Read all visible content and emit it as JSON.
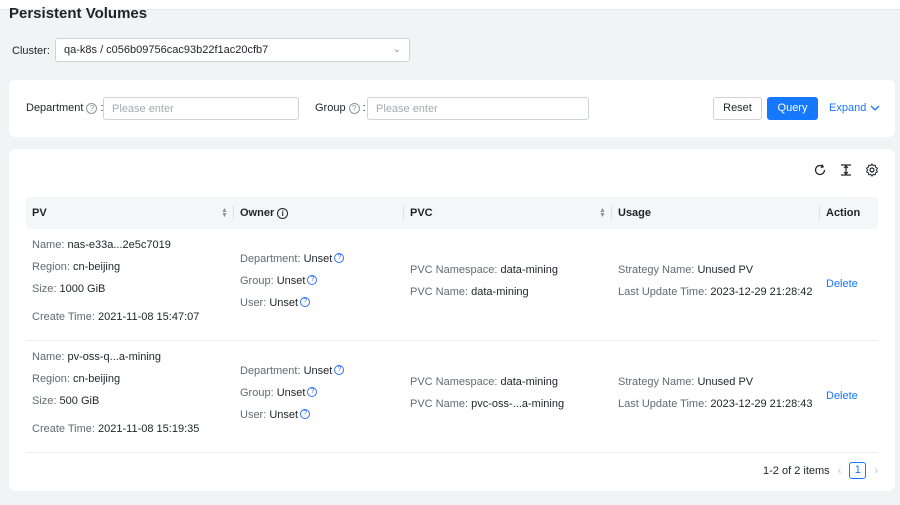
{
  "page": {
    "title": "Persistent Volumes"
  },
  "cluster": {
    "label": "Cluster:",
    "value": "qa-k8s / c056b09756cac93b22f1ac20cfb7"
  },
  "filters": {
    "department_label": "Department",
    "department_placeholder": "Please enter",
    "group_label": "Group",
    "group_placeholder": "Please enter",
    "reset_label": "Reset",
    "query_label": "Query",
    "expand_label": "Expand"
  },
  "table": {
    "columns": [
      "PV",
      "Owner",
      "PVC",
      "Usage",
      "Action"
    ],
    "rows": [
      {
        "pv": {
          "name_key": "Name:",
          "name": "nas-e33a...2e5c7019",
          "region_key": "Region:",
          "region": "cn-beijing",
          "size_key": "Size:",
          "size": "1000 GiB",
          "create_key": "Create Time:",
          "create": "2021-11-08 15:47:07"
        },
        "owner": {
          "dept_key": "Department:",
          "dept": "Unset",
          "group_key": "Group:",
          "group": "Unset",
          "user_key": "User:",
          "user": "Unset"
        },
        "pvc": {
          "ns_key": "PVC Namespace:",
          "ns": "data-mining",
          "name_key": "PVC Name:",
          "name": "data-mining"
        },
        "usage": {
          "strategy_key": "Strategy Name:",
          "strategy": "Unused PV",
          "update_key": "Last Update Time:",
          "update": "2023-12-29 21:28:42"
        },
        "action": "Delete"
      },
      {
        "pv": {
          "name_key": "Name:",
          "name": "pv-oss-q...a-mining",
          "region_key": "Region:",
          "region": "cn-beijing",
          "size_key": "Size:",
          "size": "500 GiB",
          "create_key": "Create Time:",
          "create": "2021-11-08 15:19:35"
        },
        "owner": {
          "dept_key": "Department:",
          "dept": "Unset",
          "group_key": "Group:",
          "group": "Unset",
          "user_key": "User:",
          "user": "Unset"
        },
        "pvc": {
          "ns_key": "PVC Namespace:",
          "ns": "data-mining",
          "name_key": "PVC Name:",
          "name": "pvc-oss-...a-mining"
        },
        "usage": {
          "strategy_key": "Strategy Name:",
          "strategy": "Unused PV",
          "update_key": "Last Update Time:",
          "update": "2023-12-29 21:28:43"
        },
        "action": "Delete"
      }
    ]
  },
  "pagination": {
    "summary": "1-2 of 2 items",
    "current_page": "1"
  },
  "icons": {
    "refresh": "refresh-icon",
    "density": "column-height-icon",
    "settings": "gear-icon"
  },
  "colors": {
    "primary": "#1677ff",
    "background": "#f2f3f5"
  }
}
